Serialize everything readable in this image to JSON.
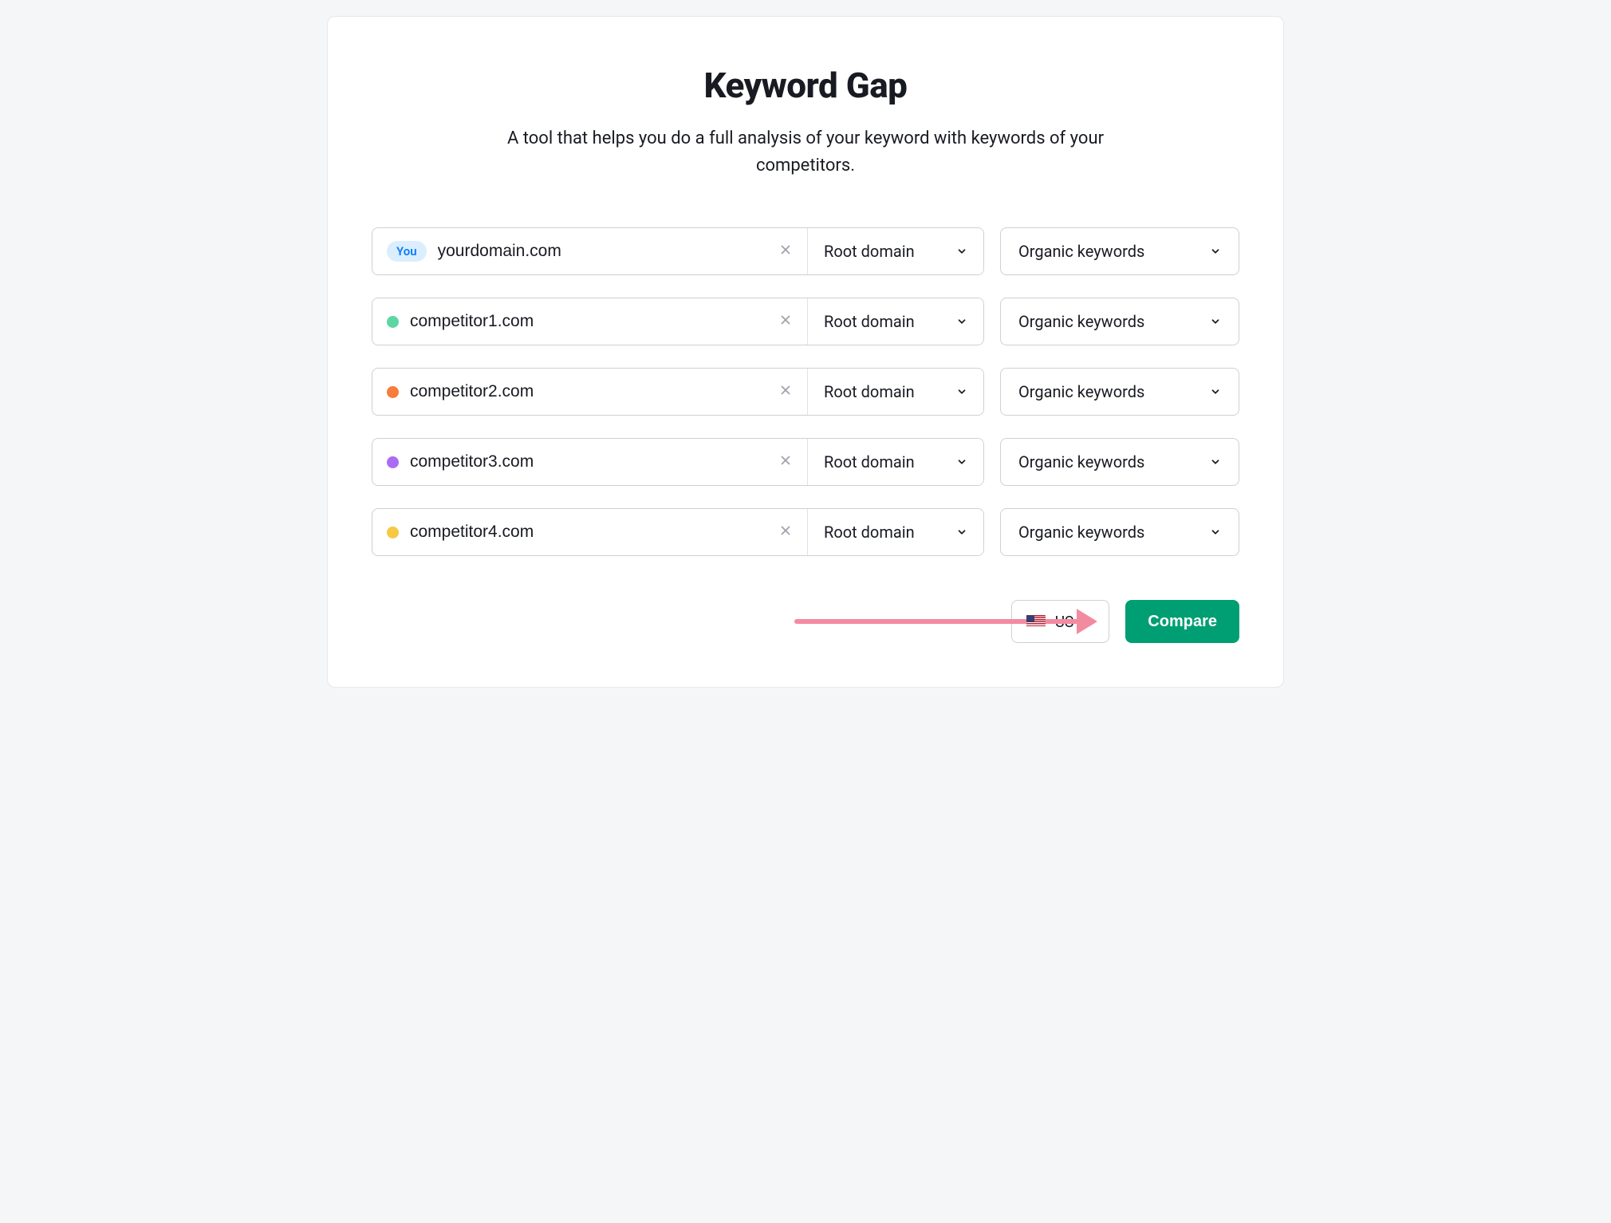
{
  "header": {
    "title": "Keyword Gap",
    "subtitle": "A tool that helps you do a full analysis of your keyword with keywords of your competitors."
  },
  "rows": [
    {
      "badge": "You",
      "dot": null,
      "value": "yourdomain.com",
      "scope": "Root domain",
      "keywords": "Organic keywords"
    },
    {
      "badge": null,
      "dot": "#5ed6a3",
      "value": "competitor1.com",
      "scope": "Root domain",
      "keywords": "Organic keywords"
    },
    {
      "badge": null,
      "dot": "#f77d3c",
      "value": "competitor2.com",
      "scope": "Root domain",
      "keywords": "Organic keywords"
    },
    {
      "badge": null,
      "dot": "#ab6cf5",
      "value": "competitor3.com",
      "scope": "Root domain",
      "keywords": "Organic keywords"
    },
    {
      "badge": null,
      "dot": "#f6c945",
      "value": "competitor4.com",
      "scope": "Root domain",
      "keywords": "Organic keywords"
    }
  ],
  "footer": {
    "country": "US",
    "compare": "Compare"
  }
}
